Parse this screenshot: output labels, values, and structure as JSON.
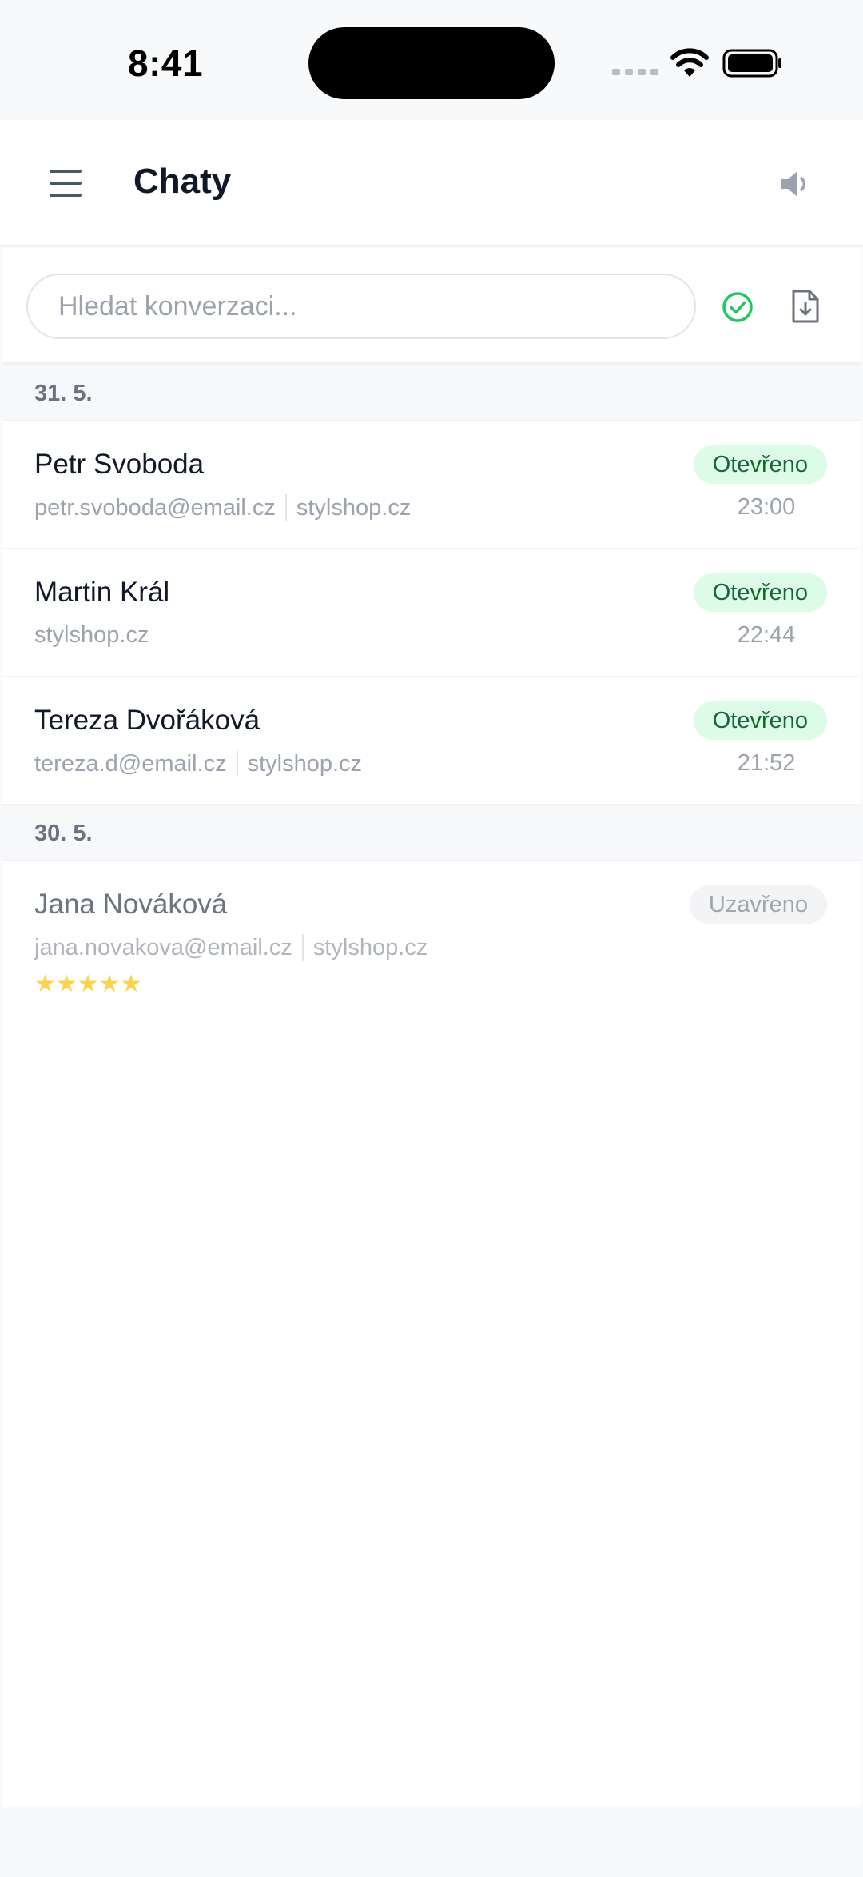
{
  "status_bar": {
    "time": "8:41"
  },
  "header": {
    "title": "Chaty",
    "menu_icon": "hamburger-menu-icon",
    "sound_icon": "speaker-icon"
  },
  "toolbar": {
    "search_placeholder": "Hledat konverzaci...",
    "search_value": "",
    "filter_icon": "check-circle-icon",
    "export_icon": "file-download-icon"
  },
  "groups": [
    {
      "date": "31. 5.",
      "chats": [
        {
          "name": "Petr Svoboda",
          "email": "petr.svoboda@email.cz",
          "site": "stylshop.cz",
          "status": "Otevřeno",
          "time": "23:00"
        },
        {
          "name": "Martin Král",
          "email": "",
          "site": "stylshop.cz",
          "status": "Otevřeno",
          "time": "22:44"
        },
        {
          "name": "Tereza Dvořáková",
          "email": "tereza.d@email.cz",
          "site": "stylshop.cz",
          "status": "Otevřeno",
          "time": "21:52"
        }
      ]
    },
    {
      "date": "30. 5.",
      "chats": [
        {
          "name": "Jana Nováková",
          "email": "jana.novakova@email.cz",
          "site": "stylshop.cz",
          "status": "Uzavřeno",
          "rating": 5,
          "rating_glyphs": "★★★★★"
        }
      ]
    }
  ],
  "colors": {
    "open_badge_bg": "#dcfce7",
    "open_badge_text": "#166534",
    "closed_badge_bg": "#f3f4f6",
    "accent_green": "#22c55e",
    "star": "#fcd34d"
  }
}
